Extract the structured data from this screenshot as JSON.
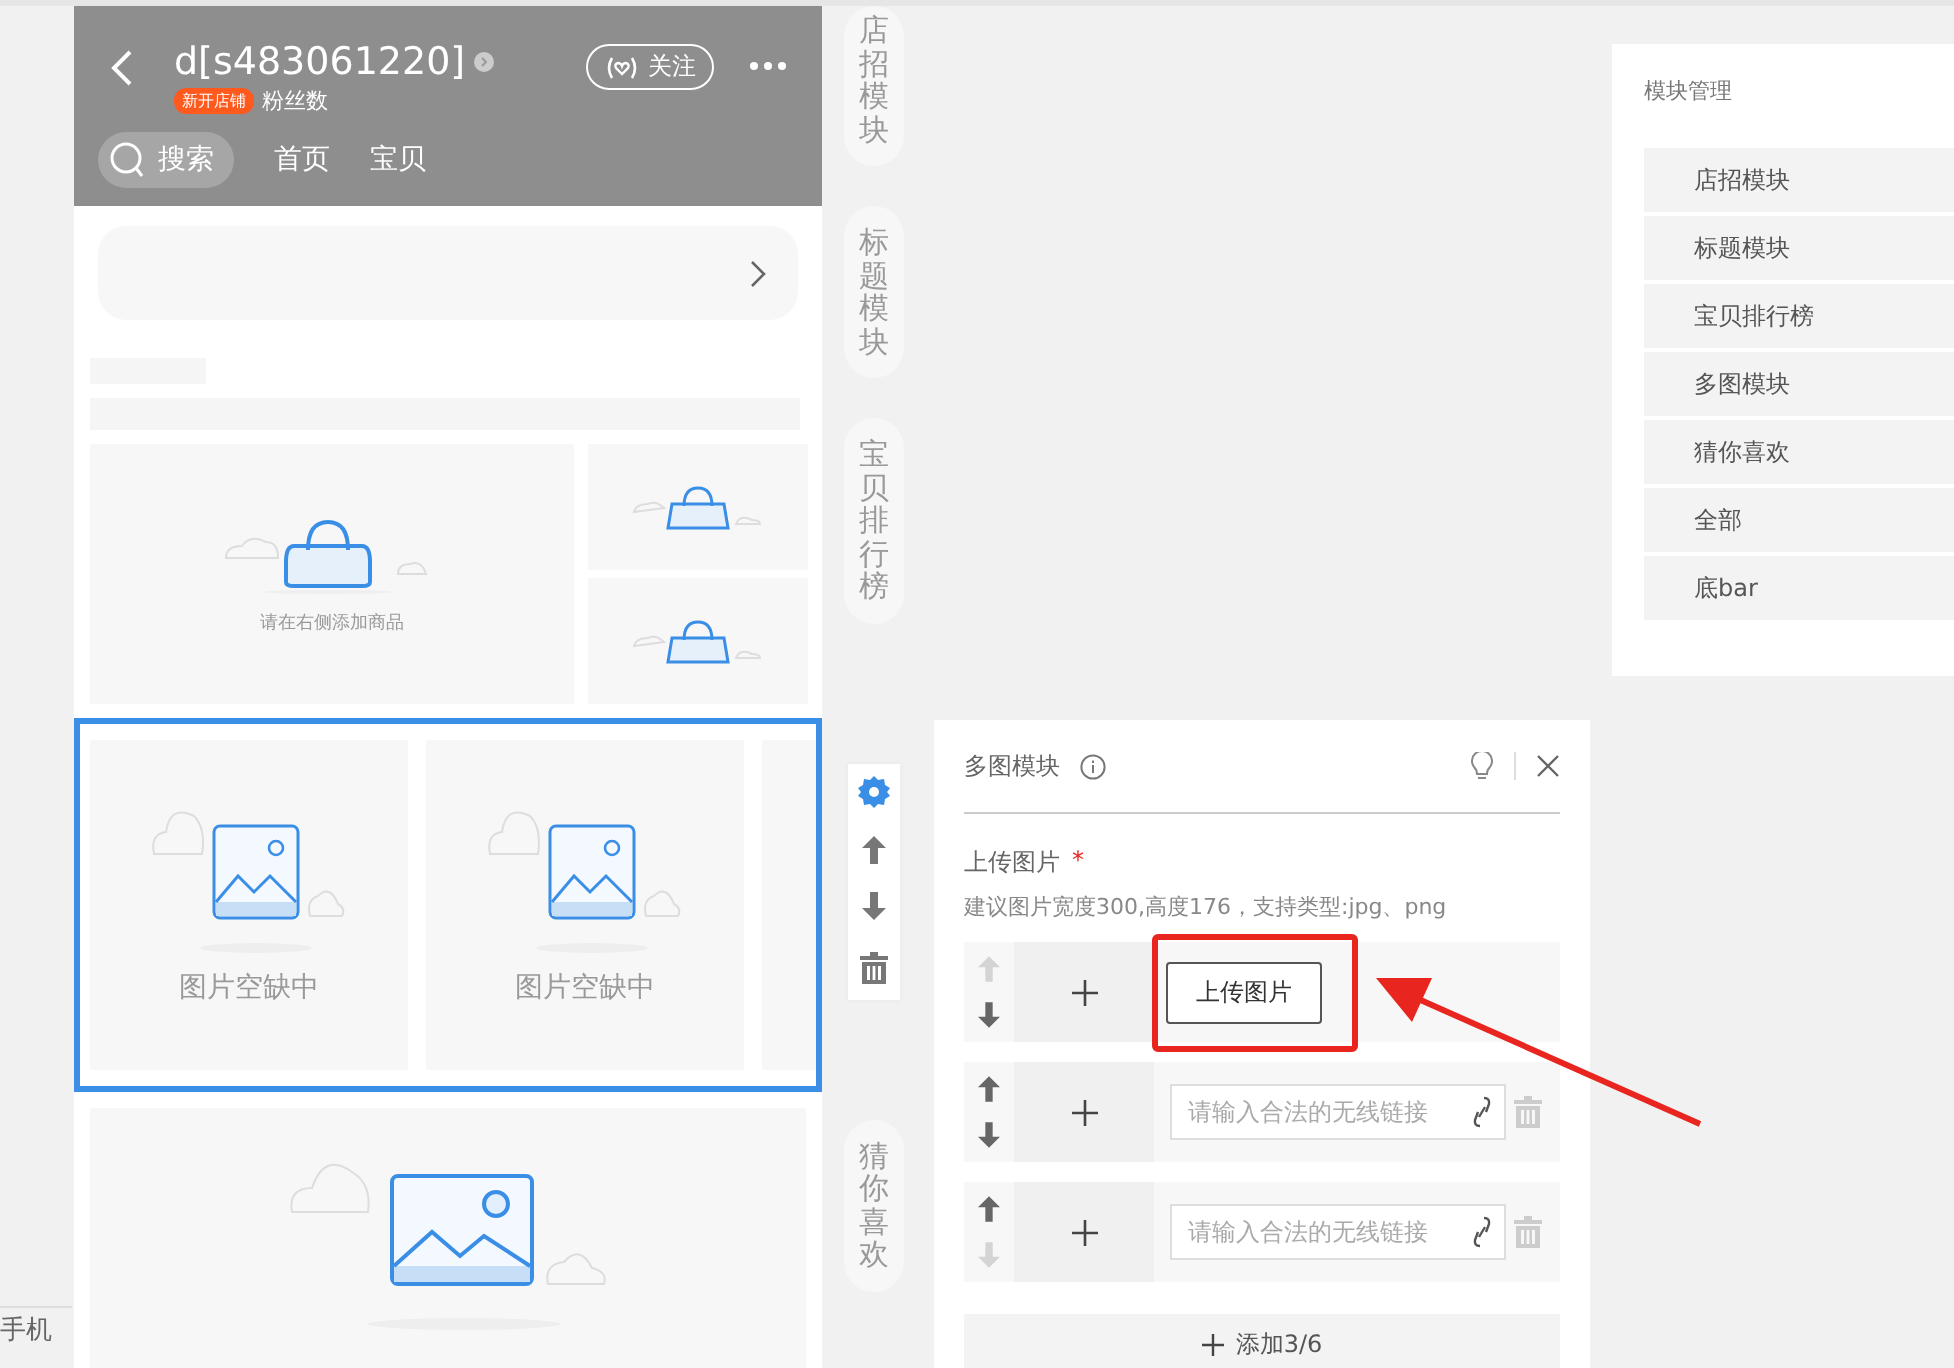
{
  "left_strip": {
    "label": "手机"
  },
  "shop_header": {
    "shop_name": "d[s483061220]",
    "badge": "新开店铺",
    "fans_label": "粉丝数",
    "follow_button": "关注",
    "search_button": "搜索",
    "nav_links": [
      "首页",
      "宝贝"
    ]
  },
  "goods_section": {
    "placeholder": "请在右侧添加商品"
  },
  "multi_image_module": {
    "selected": true,
    "tiles": [
      "图片空缺中",
      "图片空缺中"
    ]
  },
  "side_labels_top": [
    "店招模块",
    "标题模块",
    "宝贝排行榜"
  ],
  "side_labels_bottom": [
    "猜你喜欢"
  ],
  "editor": {
    "title": "多图模块",
    "upload_label": "上传图片",
    "required_mark": "*",
    "hint": "建议图片宽度300,高度176，支持类型:jpg、png",
    "items": [
      {
        "kind": "upload",
        "button": "上传图片",
        "up_disabled": true,
        "down_disabled": false
      },
      {
        "kind": "link",
        "placeholder": "请输入合法的无线链接",
        "up_disabled": false,
        "down_disabled": false
      },
      {
        "kind": "link",
        "placeholder": "请输入合法的无线链接",
        "up_disabled": false,
        "down_disabled": true
      }
    ],
    "add_button": "添加3/6"
  },
  "module_manager": {
    "title": "模块管理",
    "items": [
      "店招模块",
      "标题模块",
      "宝贝排行榜",
      "多图模块",
      "猜你喜欢",
      "全部",
      "底bar"
    ]
  }
}
